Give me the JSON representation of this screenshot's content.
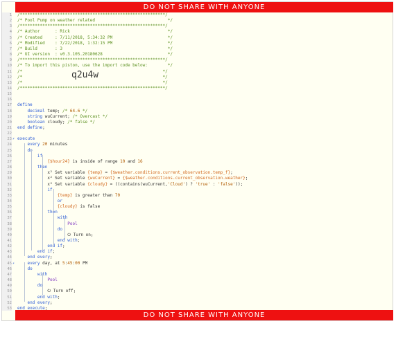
{
  "banner": {
    "top": "DO NOT SHARE WITH ANYONE",
    "bottom": "DO NOT SHARE WITH ANYONE"
  },
  "import_code": "q2u4w",
  "lines": [
    {
      "n": "1",
      "t": "/**********************************************************/"
    },
    {
      "n": "2",
      "t": "/* Pool Pump on weather related                             */"
    },
    {
      "n": "3",
      "t": "/**********************************************************/"
    },
    {
      "n": "4",
      "t": "/* Author      : Rick                                       */"
    },
    {
      "n": "5",
      "t": "/* Created     : 7/11/2018, 5:34:32 PM                      */"
    },
    {
      "n": "6",
      "t": "/* Modified    : 7/22/2018, 1:32:15 PM                      */"
    },
    {
      "n": "7",
      "t": "/* Build       : 3                                          */"
    },
    {
      "n": "8",
      "t": "/* UI version  : v0.3.105.20180628                          */"
    },
    {
      "n": "9",
      "t": "/**********************************************************/"
    },
    {
      "n": "10",
      "t": "/* To import this piston, use the import code below:        */"
    },
    {
      "n": "11",
      "t": "/*                                                        */"
    },
    {
      "n": "12",
      "t": "/*                                                        */"
    },
    {
      "n": "13",
      "t": "/*                                                        */"
    },
    {
      "n": "14",
      "t": "/**********************************************************/"
    },
    {
      "n": "15",
      "t": ""
    },
    {
      "n": "16",
      "t": ""
    },
    {
      "n": "17",
      "t": "define"
    },
    {
      "n": "18",
      "t": "    decimal temp; /* 64.6 */"
    },
    {
      "n": "19",
      "t": "    string wuCurrent; /* Overcast */"
    },
    {
      "n": "20",
      "t": "    boolean cloudy; /* false */"
    },
    {
      "n": "21",
      "t": "end define;"
    },
    {
      "n": "22",
      "t": ""
    },
    {
      "n": "23",
      "t": "execute"
    },
    {
      "n": "24",
      "t": "    every 20 minutes"
    },
    {
      "n": "25",
      "t": "    do"
    },
    {
      "n": "26",
      "t": "        if"
    },
    {
      "n": "27",
      "t": "            {$hour24} is inside of range 10 and 16"
    },
    {
      "n": "28",
      "t": "        then"
    },
    {
      "n": "29",
      "t": "            x² Set variable {temp} = {$weather.conditions.current_observation.temp_f};"
    },
    {
      "n": "30",
      "t": "            x² Set variable {wuCurrent} = {$weather.conditions.current_observation.weather};"
    },
    {
      "n": "31",
      "t": "            x² Set variable {cloudy} = ((contains(wuCurrent,'Cloud') ? 'true' : 'false'));"
    },
    {
      "n": "32",
      "t": "            if"
    },
    {
      "n": "33",
      "t": "                {temp} is greater than 70"
    },
    {
      "n": "34",
      "t": "                or"
    },
    {
      "n": "35",
      "t": "                {cloudy} is false"
    },
    {
      "n": "36",
      "t": "            then"
    },
    {
      "n": "37",
      "t": "                with"
    },
    {
      "n": "38",
      "t": "                    Pool"
    },
    {
      "n": "39",
      "t": "                do"
    },
    {
      "n": "40",
      "t": "                    ⏻ Turn on;"
    },
    {
      "n": "41",
      "t": "                end with;"
    },
    {
      "n": "42",
      "t": "            end if;"
    },
    {
      "n": "43",
      "t": "        end if;"
    },
    {
      "n": "44",
      "t": "    end every;"
    },
    {
      "n": "45",
      "t": "    every day, at 5:45:00 PM"
    },
    {
      "n": "46",
      "t": "    do"
    },
    {
      "n": "47",
      "t": "        with"
    },
    {
      "n": "48",
      "t": "            Pool"
    },
    {
      "n": "49",
      "t": "        do"
    },
    {
      "n": "50",
      "t": "            ⏻ Turn off;"
    },
    {
      "n": "51",
      "t": "        end with;"
    },
    {
      "n": "52",
      "t": "    end every;"
    },
    {
      "n": "53",
      "t": "end execute;"
    }
  ]
}
